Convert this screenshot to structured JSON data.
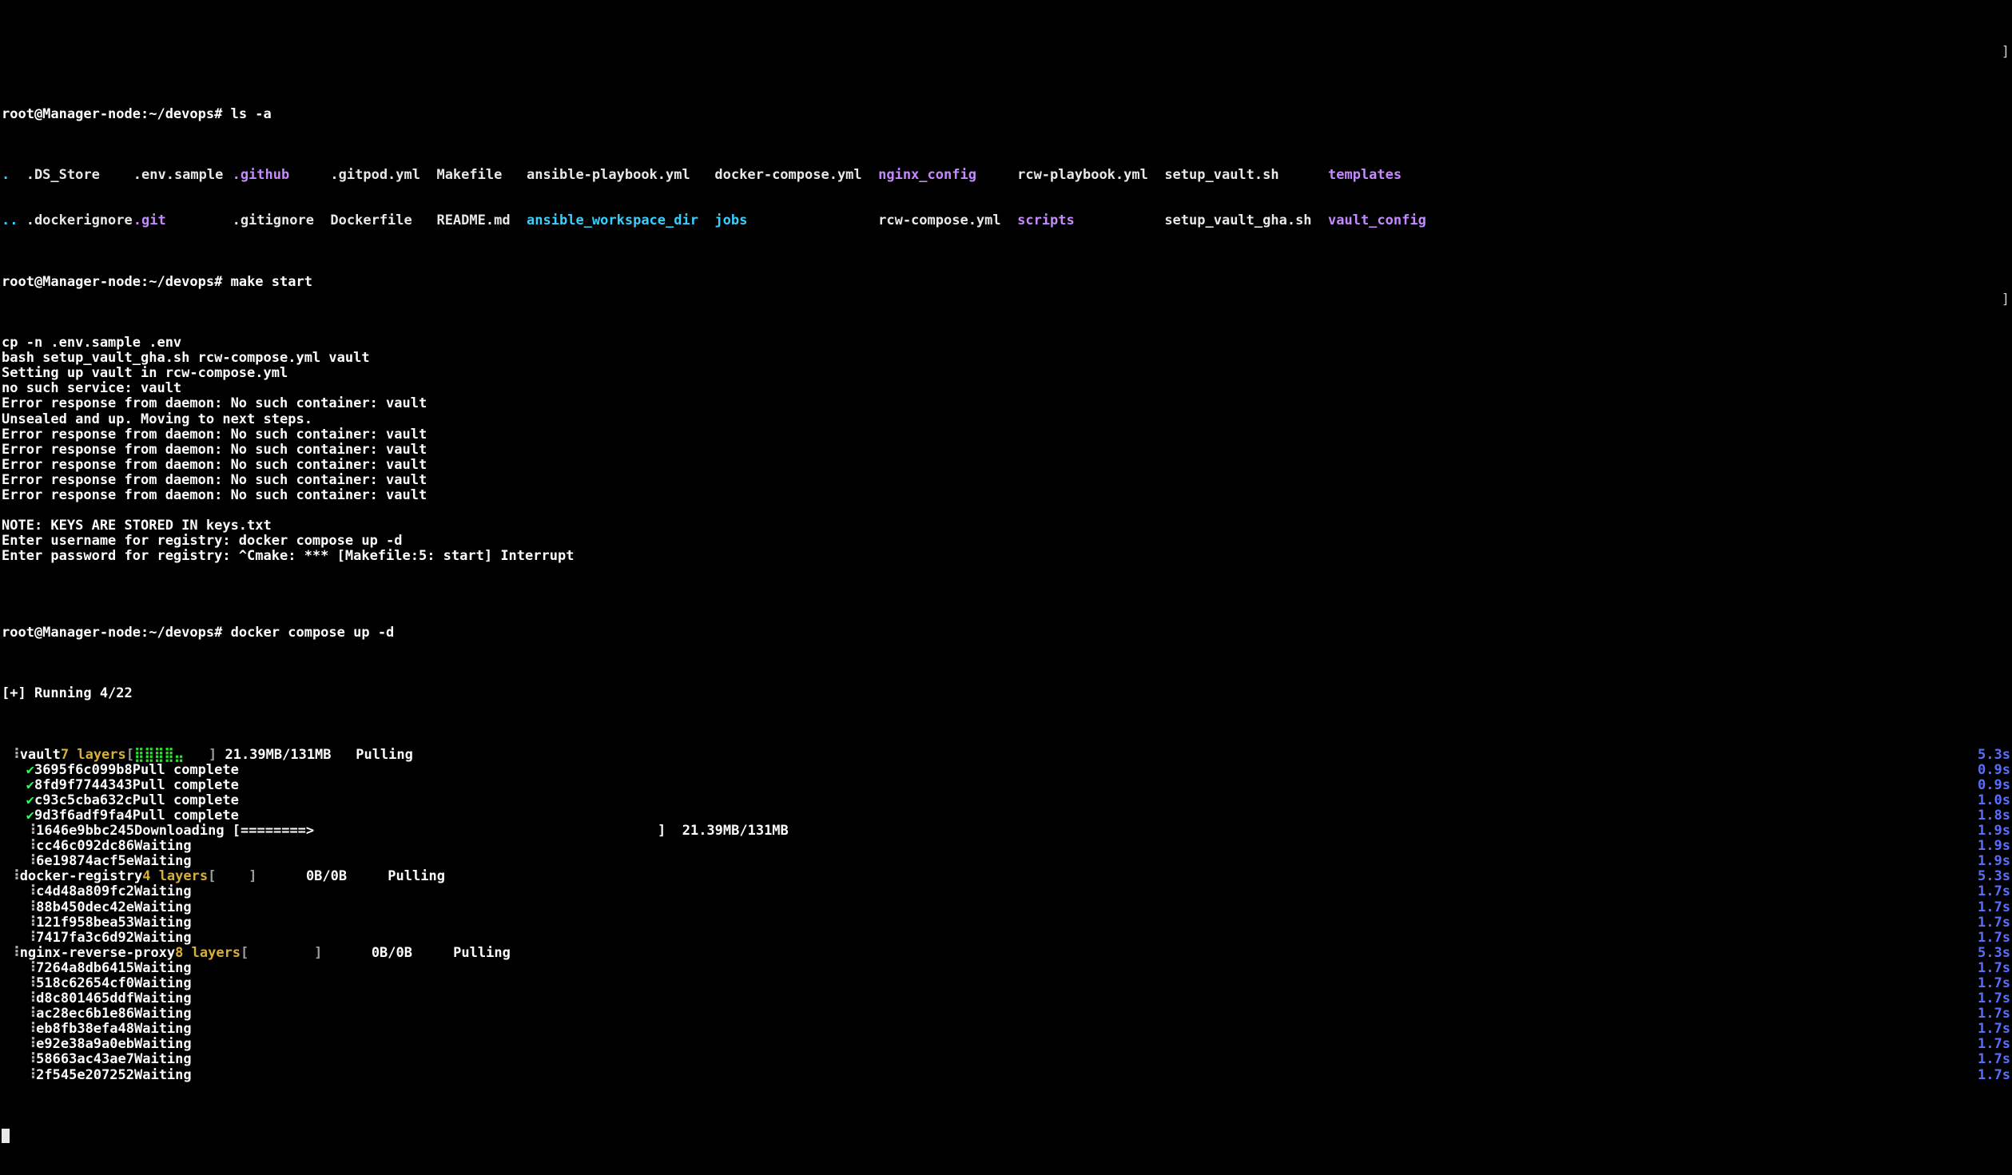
{
  "prompt": {
    "user": "root",
    "host": "Manager-node",
    "cwd": "~/devops",
    "sep": "#",
    "full": "root@Manager-node:~/devops#"
  },
  "cmds": {
    "ls": "ls -a",
    "make": "make start",
    "compose": "docker compose up -d"
  },
  "ls": {
    "row1": {
      "c0": ".",
      "c1": ".DS_Store",
      "c2": ".env.sample",
      "c3": ".github",
      "c4": ".gitpod.yml",
      "c5": "Makefile",
      "c6": "ansible-playbook.yml",
      "c7": "docker-compose.yml",
      "c8": "nginx_config",
      "c9": "rcw-playbook.yml",
      "c10": "setup_vault.sh",
      "c11": "templates"
    },
    "row2": {
      "c0": "..",
      "c1": ".dockerignore",
      "c2": ".git",
      "c3": ".gitignore",
      "c4": "Dockerfile",
      "c5": "README.md",
      "c6": "ansible_workspace_dir",
      "c7": "jobs",
      "c8": "rcw-compose.yml",
      "c9": "scripts",
      "c10": "setup_vault_gha.sh",
      "c11": "vault_config"
    }
  },
  "make_output": [
    "cp -n .env.sample .env",
    "bash setup_vault_gha.sh rcw-compose.yml vault",
    "Setting up vault in rcw-compose.yml",
    "no such service: vault",
    "Error response from daemon: No such container: vault",
    "Unsealed and up. Moving to next steps.",
    "Error response from daemon: No such container: vault",
    "Error response from daemon: No such container: vault",
    "Error response from daemon: No such container: vault",
    "Error response from daemon: No such container: vault",
    "Error response from daemon: No such container: vault",
    "",
    "NOTE: KEYS ARE STORED IN keys.txt",
    "Enter username for registry: docker compose up -d",
    "Enter password for registry: ^Cmake: *** [Makefile:5: start] Interrupt",
    ""
  ],
  "compose_header": "[+] Running 4/22",
  "compose": {
    "vault": {
      "name": "vault",
      "layers": "7 layers",
      "bar": "[⣿⣿⣿⣿⣤   ]",
      "size": "21.39MB/131MB",
      "state": "Pulling",
      "time": "5.3s",
      "items": [
        {
          "icon": "tick",
          "id": "3695f6c099b8",
          "txt": "Pull complete",
          "t": "0.9s"
        },
        {
          "icon": "tick",
          "id": "8fd9f7744343",
          "txt": "Pull complete",
          "t": "0.9s"
        },
        {
          "icon": "tick",
          "id": "c93c5cba632c",
          "txt": "Pull complete",
          "t": "1.0s"
        },
        {
          "icon": "tick",
          "id": "9d3f6adf9fa4",
          "txt": "Pull complete",
          "t": "1.8s"
        },
        {
          "icon": "dl",
          "id": "1646e9bbc245",
          "txt": "Downloading [========>                                          ]  21.39MB/131MB",
          "t": "1.9s"
        },
        {
          "icon": "dl",
          "id": "cc46c092dc86",
          "txt": "Waiting",
          "t": "1.9s"
        },
        {
          "icon": "dl",
          "id": "6e19874acf5e",
          "txt": "Waiting",
          "t": "1.9s"
        }
      ]
    },
    "registry": {
      "name": "docker-registry",
      "layers": "4 layers",
      "bar": "[    ]",
      "size": "0B/0B",
      "state": "Pulling",
      "time": "5.3s",
      "items": [
        {
          "icon": "dl",
          "id": "c4d48a809fc2",
          "txt": "Waiting",
          "t": "1.7s"
        },
        {
          "icon": "dl",
          "id": "88b450dec42e",
          "txt": "Waiting",
          "t": "1.7s"
        },
        {
          "icon": "dl",
          "id": "121f958bea53",
          "txt": "Waiting",
          "t": "1.7s"
        },
        {
          "icon": "dl",
          "id": "7417fa3c6d92",
          "txt": "Waiting",
          "t": "1.7s"
        }
      ]
    },
    "nginx": {
      "name": "nginx-reverse-proxy",
      "layers": "8 layers",
      "bar": "[        ]",
      "size": "0B/0B",
      "state": "Pulling",
      "time": "5.3s",
      "items": [
        {
          "icon": "dl",
          "id": "7264a8db6415",
          "txt": "Waiting",
          "t": "1.7s"
        },
        {
          "icon": "dl",
          "id": "518c62654cf0",
          "txt": "Waiting",
          "t": "1.7s"
        },
        {
          "icon": "dl",
          "id": "d8c801465ddf",
          "txt": "Waiting",
          "t": "1.7s"
        },
        {
          "icon": "dl",
          "id": "ac28ec6b1e86",
          "txt": "Waiting",
          "t": "1.7s"
        },
        {
          "icon": "dl",
          "id": "eb8fb38efa48",
          "txt": "Waiting",
          "t": "1.7s"
        },
        {
          "icon": "dl",
          "id": "e92e38a9a0eb",
          "txt": "Waiting",
          "t": "1.7s"
        },
        {
          "icon": "dl",
          "id": "58663ac43ae7",
          "txt": "Waiting",
          "t": "1.7s"
        },
        {
          "icon": "dl",
          "id": "2f545e207252",
          "txt": "Waiting",
          "t": "1.7s"
        }
      ]
    }
  },
  "scroll_glyph": "]"
}
